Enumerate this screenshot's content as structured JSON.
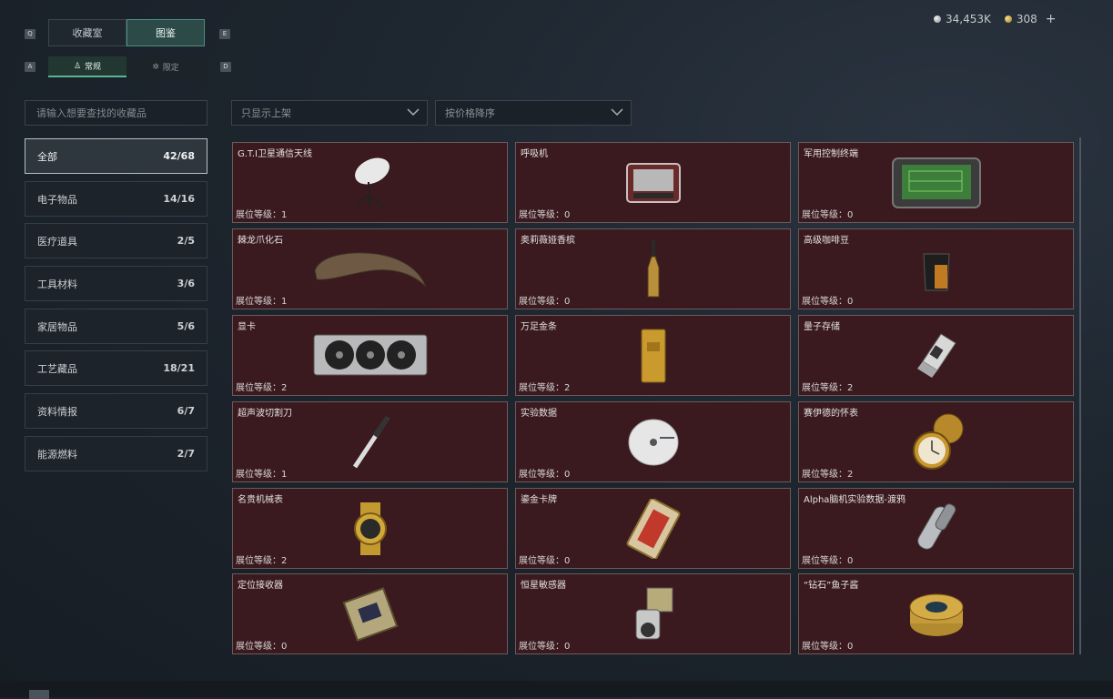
{
  "currency": {
    "silver": "34,453K",
    "gold": "308",
    "plus": "+"
  },
  "keys": {
    "q": "Q",
    "e": "E",
    "a": "A",
    "d": "D"
  },
  "tabs": [
    {
      "label": "收藏室",
      "active": false
    },
    {
      "label": "图鉴",
      "active": true
    }
  ],
  "subtabs": [
    {
      "label": "常规",
      "icon": "trophy-icon",
      "active": true
    },
    {
      "label": "限定",
      "icon": "badge-icon",
      "active": false
    }
  ],
  "search": {
    "placeholder": "请输入想要查找的收藏品"
  },
  "filters": {
    "display": "只显示上架",
    "sort": "按价格降序"
  },
  "categories": [
    {
      "label": "全部",
      "count": "42/68",
      "active": true
    },
    {
      "label": "电子物品",
      "count": "14/16"
    },
    {
      "label": "医疗道具",
      "count": "2/5"
    },
    {
      "label": "工具材料",
      "count": "3/6"
    },
    {
      "label": "家居物品",
      "count": "5/6"
    },
    {
      "label": "工艺藏品",
      "count": "18/21"
    },
    {
      "label": "资料情报",
      "count": "6/7"
    },
    {
      "label": "能源燃料",
      "count": "2/7"
    }
  ],
  "items": [
    {
      "name": "G.T.I卫星通信天线",
      "level": "展位等级：1",
      "icon": "satellite-dish-icon"
    },
    {
      "name": "呼吸机",
      "level": "展位等级：0",
      "icon": "ventilator-icon"
    },
    {
      "name": "军用控制终端",
      "level": "展位等级：0",
      "icon": "military-terminal-icon"
    },
    {
      "name": "棘龙爪化石",
      "level": "展位等级：1",
      "icon": "claw-fossil-icon"
    },
    {
      "name": "奥莉薇娅香槟",
      "level": "展位等级：0",
      "icon": "champagne-bottle-icon"
    },
    {
      "name": "高级咖啡豆",
      "level": "展位等级：0",
      "icon": "coffee-bag-icon"
    },
    {
      "name": "显卡",
      "level": "展位等级：2",
      "icon": "graphics-card-icon"
    },
    {
      "name": "万足金条",
      "level": "展位等级：2",
      "icon": "gold-bar-icon"
    },
    {
      "name": "量子存储",
      "level": "展位等级：2",
      "icon": "usb-drive-icon"
    },
    {
      "name": "超声波切割刀",
      "level": "展位等级：1",
      "icon": "ultrasonic-knife-icon"
    },
    {
      "name": "实验数据",
      "level": "展位等级：0",
      "icon": "data-disc-icon"
    },
    {
      "name": "赛伊德的怀表",
      "level": "展位等级：2",
      "icon": "pocket-watch-icon"
    },
    {
      "name": "名贵机械表",
      "level": "展位等级：2",
      "icon": "wristwatch-icon"
    },
    {
      "name": "鎏金卡牌",
      "level": "展位等级：0",
      "icon": "gilded-card-icon"
    },
    {
      "name": "Alpha脑机实验数据-渡鸦",
      "level": "展位等级：0",
      "icon": "data-capsule-icon"
    },
    {
      "name": "定位接收器",
      "level": "展位等级：0",
      "icon": "gps-receiver-icon"
    },
    {
      "name": "恒星敏感器",
      "level": "展位等级：0",
      "icon": "star-sensor-icon"
    },
    {
      "name": "“钻石”鱼子酱",
      "level": "展位等级：0",
      "icon": "caviar-tin-icon"
    }
  ]
}
